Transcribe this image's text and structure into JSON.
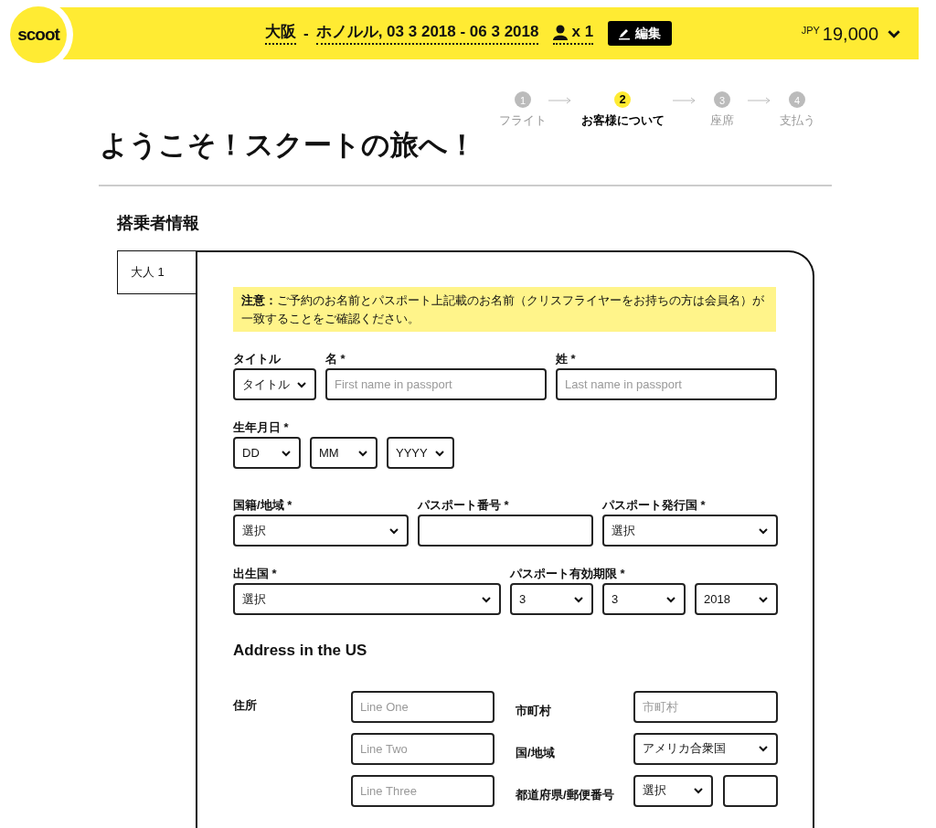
{
  "logo": "scoot",
  "header": {
    "origin": "大阪",
    "separator": "-",
    "route": "ホノルル, 03 3 2018 - 06 3 2018",
    "passengers": "x 1",
    "edit_button": "編集",
    "currency": "JPY",
    "price": "19,000"
  },
  "steps": [
    {
      "number": "1",
      "label": "フライト",
      "selected": false
    },
    {
      "number": "2",
      "label": "お客様について",
      "selected": true
    },
    {
      "number": "3",
      "label": "座席",
      "selected": false
    },
    {
      "number": "4",
      "label": "支払う",
      "selected": false
    }
  ],
  "page_title": "ようこそ！スクートの旅へ！",
  "section_title": "搭乗者情報",
  "passenger_tabs": [
    {
      "label": "大人 1",
      "selected": true
    }
  ],
  "notice": "**注意：**ご予約のお名前とパスポート上記載のお名前（クリスフライヤーをお持ちの方は会員名）が一致することをご確認ください。",
  "form_rows": [
    {
      "groups": [
        {
          "label": "タイトル",
          "fields": [
            {
              "kind": "select",
              "value": "タイトル"
            }
          ]
        },
        {
          "label": "名 *",
          "fields": [
            {
              "kind": "text",
              "placeholder": "First name in passport"
            }
          ]
        },
        {
          "label": "姓 *",
          "fields": [
            {
              "kind": "text",
              "placeholder": "Last name in passport"
            }
          ]
        }
      ]
    },
    {
      "groups": [
        {
          "label": "生年月日 *",
          "fields": [
            {
              "kind": "select",
              "value": "DD"
            },
            {
              "kind": "select",
              "value": "MM"
            },
            {
              "kind": "select",
              "value": "YYYY"
            }
          ]
        }
      ]
    },
    {
      "groups": [
        {
          "label": "国籍/地域 *",
          "fields": [
            {
              "kind": "select",
              "value": "選択"
            }
          ]
        },
        {
          "label": "パスポート番号 *",
          "fields": [
            {
              "kind": "text"
            }
          ]
        },
        {
          "label": "パスポート発行国 *",
          "fields": [
            {
              "kind": "select",
              "value": "選択"
            }
          ]
        }
      ]
    },
    {
      "groups": [
        {
          "label": "出生国 *",
          "fields": [
            {
              "kind": "select",
              "value": "選択"
            }
          ]
        },
        {
          "label": "パスポート有効期限 *",
          "fields": [
            {
              "kind": "select",
              "value": "3"
            },
            {
              "kind": "select",
              "value": "3"
            },
            {
              "kind": "select",
              "value": "2018"
            }
          ]
        }
      ]
    }
  ],
  "address": {
    "heading": "Address in the US",
    "left": {
      "label": "住所",
      "fields": [
        {
          "kind": "text",
          "placeholder": "Line One"
        },
        {
          "kind": "text",
          "placeholder": "Line Two"
        },
        {
          "kind": "text",
          "placeholder": "Line Three"
        }
      ]
    },
    "right": [
      {
        "label": "市町村",
        "fields": [
          {
            "kind": "text",
            "placeholder": "市町村"
          }
        ]
      },
      {
        "label": "国/地域",
        "fields": [
          {
            "kind": "select",
            "value": "アメリカ合衆国"
          }
        ]
      },
      {
        "label": "都道府県/郵便番号",
        "fields": [
          {
            "kind": "select",
            "value": "選択"
          },
          {
            "kind": "text"
          }
        ]
      }
    ]
  }
}
